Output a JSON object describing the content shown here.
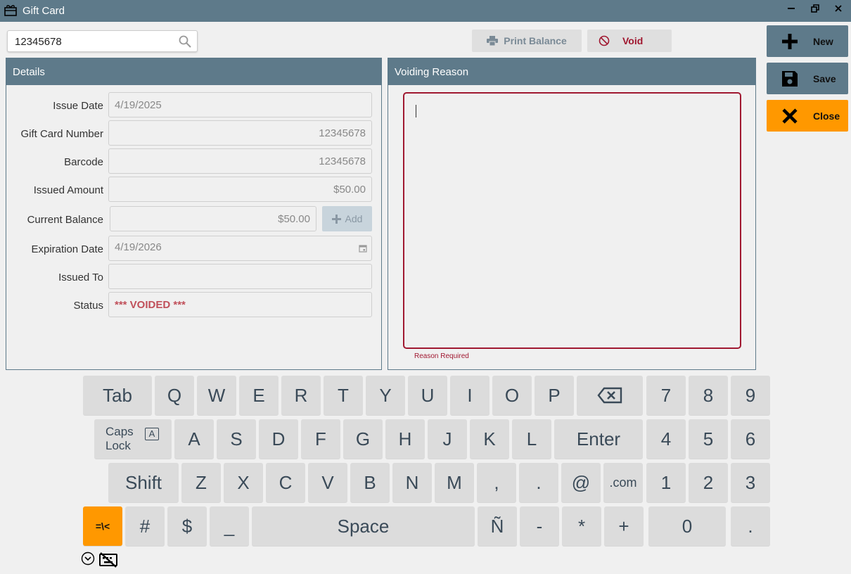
{
  "window": {
    "title": "Gift Card",
    "icons": [
      "gift-card-icon",
      "minimize-icon",
      "restore-icon",
      "close-icon"
    ]
  },
  "search": {
    "value": "12345678",
    "icon": "search-icon"
  },
  "toolbar": {
    "print_balance": "Print Balance",
    "void": "Void"
  },
  "actions": {
    "new": "New",
    "save": "Save",
    "close": "Close"
  },
  "details": {
    "title": "Details",
    "fields": [
      {
        "label": "Issue Date",
        "value": "4/19/2025"
      },
      {
        "label": "Gift Card Number",
        "value": "12345678"
      },
      {
        "label": "Barcode",
        "value": "12345678"
      },
      {
        "label": "Issued Amount",
        "value": "$50.00"
      },
      {
        "label": "Current Balance",
        "value": "$50.00"
      },
      {
        "label": "Expiration Date",
        "value": "4/19/2026"
      },
      {
        "label": "Issued To",
        "value": ""
      },
      {
        "label": "Status",
        "value": "*** VOIDED ***"
      }
    ],
    "add_label": "Add"
  },
  "voiding": {
    "title": "Voiding Reason",
    "value": "",
    "error": "Reason Required"
  },
  "keyboard": {
    "row1": [
      "Tab",
      "Q",
      "W",
      "E",
      "R",
      "T",
      "Y",
      "U",
      "I",
      "O",
      "P",
      "⌫",
      "7",
      "8",
      "9"
    ],
    "row2": [
      "Caps Lock",
      "A",
      "S",
      "D",
      "F",
      "G",
      "H",
      "J",
      "K",
      "L",
      "Enter",
      "4",
      "5",
      "6"
    ],
    "row3": [
      "Shift",
      "Z",
      "X",
      "C",
      "V",
      "B",
      "N",
      "M",
      ",",
      ".",
      "@",
      ".com",
      "1",
      "2",
      "3"
    ],
    "row4": [
      "=\\<",
      "#",
      "$",
      "_",
      "Space",
      "Ñ",
      "-",
      "*",
      "+",
      "0",
      "."
    ],
    "caps_indicator": "A"
  },
  "colors": {
    "header": "#5e7a8a",
    "accent": "#ff9800",
    "error": "#a01830"
  }
}
